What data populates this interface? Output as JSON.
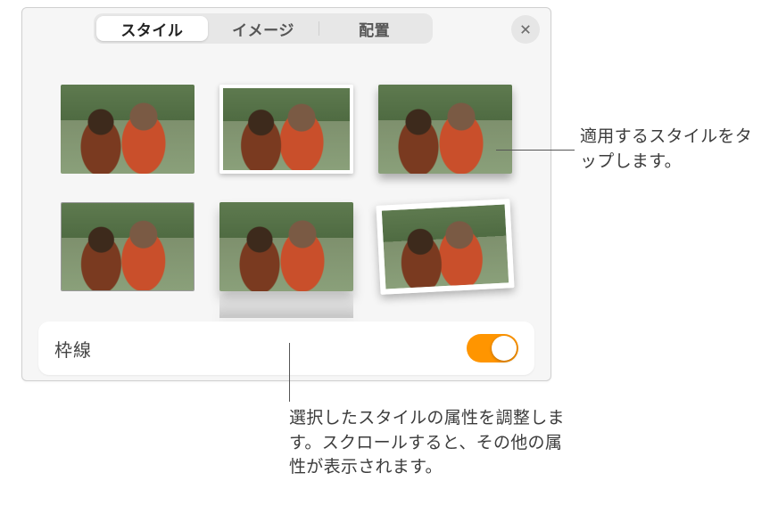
{
  "tabs": {
    "style": "スタイル",
    "image": "イメージ",
    "arrange": "配置",
    "active_index": 0
  },
  "style_thumbs": [
    {
      "name": "plain"
    },
    {
      "name": "white-border"
    },
    {
      "name": "drop-shadow"
    },
    {
      "name": "thin-line"
    },
    {
      "name": "reflection"
    },
    {
      "name": "polaroid-tilt"
    }
  ],
  "border_row": {
    "label": "枠線",
    "enabled": true
  },
  "callouts": {
    "top": "適用するスタイルをタップします。",
    "bottom": "選択したスタイルの属性を調整します。スクロールすると、その他の属性が表示されます。"
  },
  "colors": {
    "accent": "#ff9500"
  }
}
